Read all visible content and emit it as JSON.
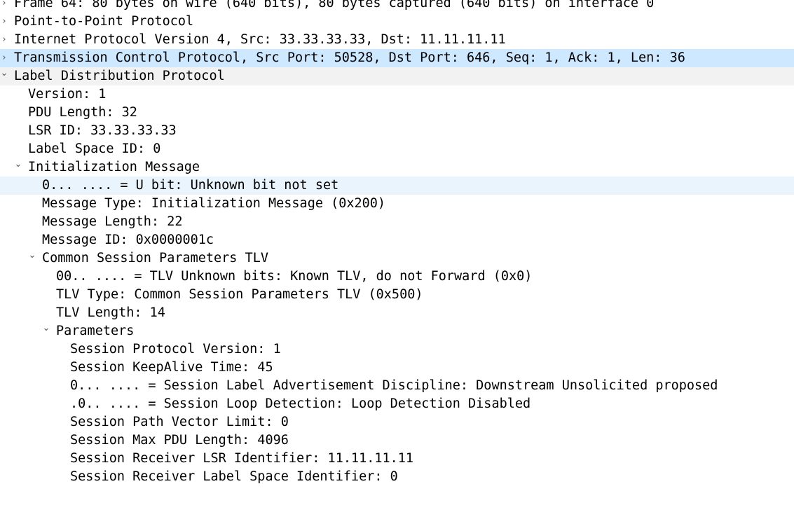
{
  "rows": [
    {
      "text": "Frame 64: 80 bytes on wire (640 bits), 80 bytes captured (640 bits) on interface 0",
      "chevron": "chevron-right-icon"
    },
    {
      "text": "Point-to-Point Protocol",
      "chevron": "chevron-right-icon"
    },
    {
      "text": "Internet Protocol Version 4, Src: 33.33.33.33, Dst: 11.11.11.11",
      "chevron": "chevron-right-icon"
    },
    {
      "text": "Transmission Control Protocol, Src Port: 50528, Dst Port: 646, Seq: 1, Ack: 1, Len: 36",
      "chevron": "chevron-right-icon",
      "selected": true
    },
    {
      "text": "Label Distribution Protocol",
      "chevron": "chevron-down-icon"
    },
    {
      "text": "Version: 1"
    },
    {
      "text": "PDU Length: 32"
    },
    {
      "text": "LSR ID: 33.33.33.33"
    },
    {
      "text": "Label Space ID: 0"
    },
    {
      "text": "Initialization Message",
      "chevron": "chevron-down-icon"
    },
    {
      "text": "0... .... = U bit: Unknown bit not set"
    },
    {
      "text": "Message Type: Initialization Message (0x200)"
    },
    {
      "text": "Message Length: 22"
    },
    {
      "text": "Message ID: 0x0000001c"
    },
    {
      "text": "Common Session Parameters TLV",
      "chevron": "chevron-down-icon"
    },
    {
      "text": "00.. .... = TLV Unknown bits: Known TLV, do not Forward (0x0)"
    },
    {
      "text": "TLV Type: Common Session Parameters TLV (0x500)"
    },
    {
      "text": "TLV Length: 14"
    },
    {
      "text": "Parameters",
      "chevron": "chevron-down-icon"
    },
    {
      "text": "Session Protocol Version: 1"
    },
    {
      "text": "Session KeepAlive Time: 45"
    },
    {
      "text": "0... .... = Session Label Advertisement Discipline: Downstream Unsolicited proposed"
    },
    {
      "text": ".0.. .... = Session Loop Detection: Loop Detection Disabled"
    },
    {
      "text": "Session Path Vector Limit: 0"
    },
    {
      "text": "Session Max PDU Length: 4096"
    },
    {
      "text": "Session Receiver LSR Identifier: 11.11.11.11"
    },
    {
      "text": "Session Receiver Label Space Identifier: 0"
    }
  ],
  "colors": {
    "selected_row": "#cde8ff",
    "hover_row": "#eaf4fd",
    "parent_row": "#f2f2f2"
  }
}
